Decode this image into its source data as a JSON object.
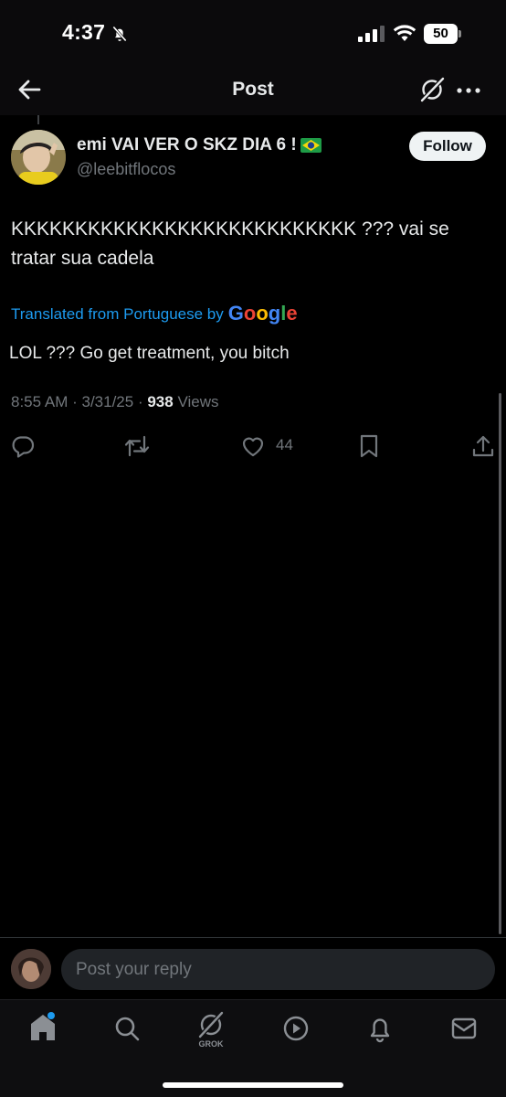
{
  "status_bar": {
    "time": "4:37",
    "battery": "50",
    "icons": [
      "bell-slash-icon",
      "cellular-signal-icon",
      "wifi-icon",
      "battery-icon"
    ]
  },
  "header": {
    "title": "Post",
    "icons": [
      "back-arrow-icon",
      "grok-icon",
      "more-icon"
    ]
  },
  "post": {
    "author_name": "emi VAI VER O SKZ DIA 6 !",
    "author_flag": "brazil-flag-icon",
    "author_handle": "@leebitflocos",
    "follow_label": "Follow",
    "text": "KKKKKKKKKKKKKKKKKKKKKKKKKKK ??? vai se tratar sua cadela",
    "translation_label": "Translated from Portuguese by",
    "translation_brand": "Google",
    "translation_text": "LOL ??? Go get treatment, you bitch",
    "time": "8:55 AM",
    "date": "3/31/25",
    "views_count": "938",
    "views_label": "Views",
    "like_count": "44"
  },
  "actions": [
    "reply-icon",
    "repost-icon",
    "like-icon",
    "bookmark-icon",
    "share-icon"
  ],
  "reply": {
    "placeholder": "Post your reply"
  },
  "tabbar": {
    "items": [
      "home-icon",
      "search-icon",
      "grok-icon",
      "video-icon",
      "notifications-icon",
      "messages-icon"
    ],
    "grok_label": "GROK"
  },
  "colors": {
    "background": "#000000",
    "text": "#e7e9ea",
    "muted": "#71767b",
    "link": "#1d9bf0",
    "follow_bg": "#eff3f4"
  }
}
